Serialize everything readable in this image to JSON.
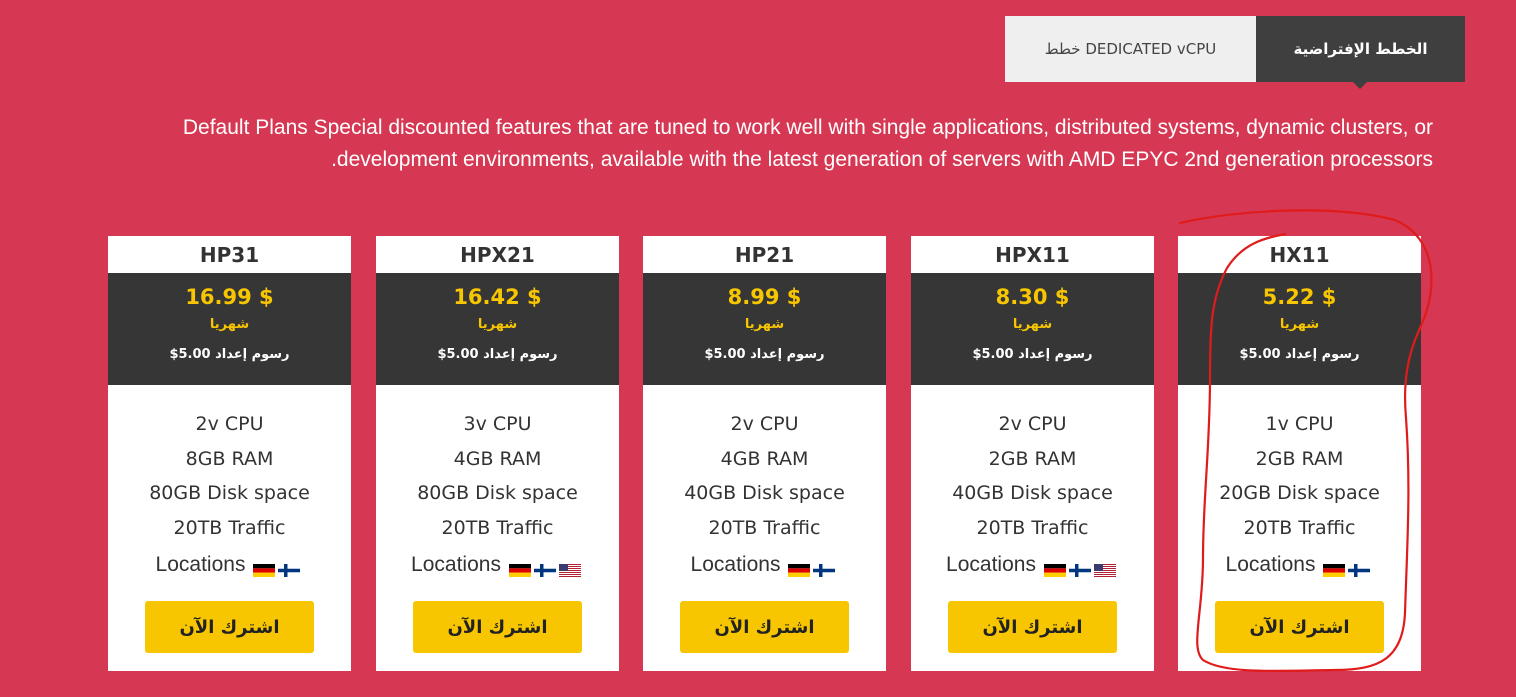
{
  "tabs": [
    {
      "label": "خطط DEDICATED vCPU"
    },
    {
      "label": "الخطط الإفتراضية"
    }
  ],
  "description": "Default Plans Special discounted features that are tuned to work well with single applications, distributed systems, dynamic clusters, or development environments, available with the latest generation of servers with AMD EPYC 2nd generation processors.",
  "plans": [
    {
      "name": "HP31",
      "price": "16.99 $",
      "period": "شهريا",
      "setup": "$5.00 رسوم إعداد",
      "cpu": "2v CPU",
      "ram": "8GB RAM",
      "disk": "80GB Disk space",
      "traffic": "20TB Traffic",
      "locations_label": "Locations",
      "flags": [
        "de",
        "fi"
      ],
      "cta": "اشترك الآن"
    },
    {
      "name": "HPX21",
      "price": "16.42 $",
      "period": "شهريا",
      "setup": "$5.00 رسوم إعداد",
      "cpu": "3v CPU",
      "ram": "4GB RAM",
      "disk": "80GB Disk space",
      "traffic": "20TB Traffic",
      "locations_label": "Locations",
      "flags": [
        "de",
        "fi",
        "us"
      ],
      "cta": "اشترك الآن"
    },
    {
      "name": "HP21",
      "price": "8.99 $",
      "period": "شهريا",
      "setup": "$5.00 رسوم إعداد",
      "cpu": "2v CPU",
      "ram": "4GB RAM",
      "disk": "40GB Disk space",
      "traffic": "20TB Traffic",
      "locations_label": "Locations",
      "flags": [
        "de",
        "fi"
      ],
      "cta": "اشترك الآن"
    },
    {
      "name": "HPX11",
      "price": "8.30 $",
      "period": "شهريا",
      "setup": "$5.00 رسوم إعداد",
      "cpu": "2v CPU",
      "ram": "2GB RAM",
      "disk": "40GB Disk space",
      "traffic": "20TB Traffic",
      "locations_label": "Locations",
      "flags": [
        "de",
        "fi",
        "us"
      ],
      "cta": "اشترك الآن"
    },
    {
      "name": "HX11",
      "price": "5.22 $",
      "period": "شهريا",
      "setup": "$5.00 رسوم إعداد",
      "cpu": "1v CPU",
      "ram": "2GB RAM",
      "disk": "20GB Disk space",
      "traffic": "20TB Traffic",
      "locations_label": "Locations",
      "flags": [
        "de",
        "fi"
      ],
      "cta": "اشترك الآن"
    }
  ],
  "colors": {
    "background": "#d63853",
    "price_box": "#363636",
    "accent_yellow": "#f7c600",
    "tab_active": "#3f3f3f",
    "tab_inactive": "#efefef",
    "annotation": "#e01b1b"
  },
  "icons": {
    "de": "germany-flag-icon",
    "fi": "finland-flag-icon",
    "us": "usa-flag-icon"
  }
}
